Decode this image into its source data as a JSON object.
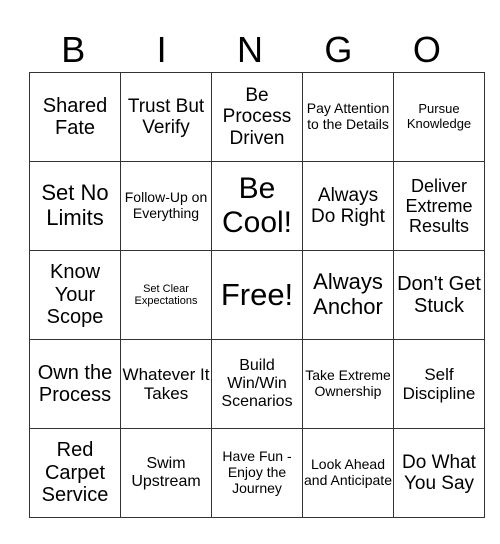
{
  "header": [
    "B",
    "I",
    "N",
    "G",
    "O"
  ],
  "cells": [
    [
      "Shared Fate",
      "Trust But Verify",
      "Be Process Driven",
      "Pay Attention to the Details",
      "Pursue Knowledge"
    ],
    [
      "Set No Limits",
      "Follow-Up on Everything",
      "Be Cool!",
      "Always Do Right",
      "Deliver Extreme Results"
    ],
    [
      "Know Your Scope",
      "Set Clear Expectations",
      "Free!",
      "Always Anchor",
      "Don't Get Stuck"
    ],
    [
      "Own the Process",
      "Whatever It Takes",
      "Build Win/Win Scenarios",
      "Take Extreme Ownership",
      "Self Discipline"
    ],
    [
      "Red Carpet Service",
      "Swim Upstream",
      "Have Fun - Enjoy the Journey",
      "Look Ahead and Anticipate",
      "Do What You Say"
    ]
  ]
}
